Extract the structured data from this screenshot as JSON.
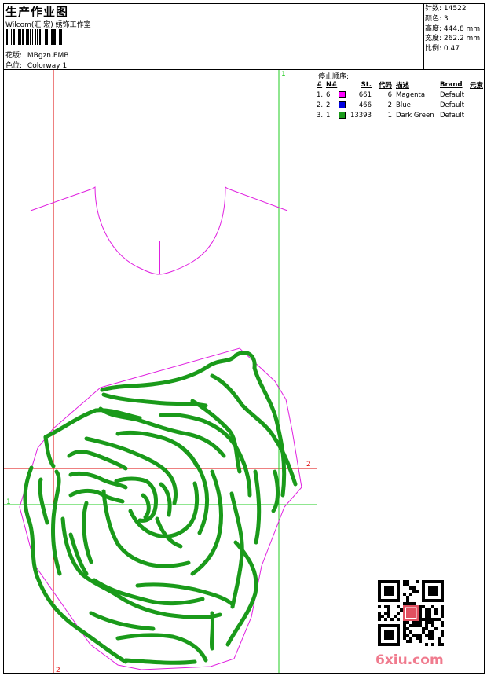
{
  "header": {
    "title": "生产作业图",
    "subtitle": "Wilcom(汇 宏) 绣饰工作室"
  },
  "design": {
    "pattern_label": "花版:",
    "pattern_value": "MBgzn.EMB",
    "colorway_label": "色位:",
    "colorway_value": "Colorway 1"
  },
  "stats": {
    "stitches_label": "针数:",
    "stitches_value": "14522",
    "colors_label": "颜色:",
    "colors_value": "3",
    "height_label": "高度:",
    "height_value": "444.8 mm",
    "width_label": "宽度:",
    "width_value": "262.2 mm",
    "scale_label": "比例:",
    "scale_value": "0.47"
  },
  "stop_sequence": {
    "title": "停止顺序:",
    "headers": [
      "#",
      "N#",
      "St.",
      "代码",
      "描述",
      "Brand",
      "元素"
    ],
    "rows": [
      {
        "idx": "1.",
        "n": "6",
        "color": "#ff00ff",
        "st": "661",
        "code": "6",
        "desc": "Magenta",
        "brand": "Default"
      },
      {
        "idx": "2.",
        "n": "2",
        "color": "#0000e0",
        "st": "466",
        "code": "2",
        "desc": "Blue",
        "brand": "Default"
      },
      {
        "idx": "3.",
        "n": "1",
        "color": "#1a9a1a",
        "st": "13393",
        "code": "1",
        "desc": "Dark Green",
        "brand": "Default"
      }
    ]
  },
  "guides": {
    "red_label_right": "2",
    "red_label_bottom": "2",
    "green_label_top": "1",
    "green_label_left": "1"
  },
  "colors": {
    "red_guide": "#dd0000",
    "green_guide": "#22cc22",
    "magenta": "#e020e0",
    "green_thread": "#1a9a1a",
    "watermark": "#f07b8e"
  },
  "watermark": {
    "text": "6xiu.com"
  },
  "icons": {
    "qr": "qr-code-icon"
  }
}
